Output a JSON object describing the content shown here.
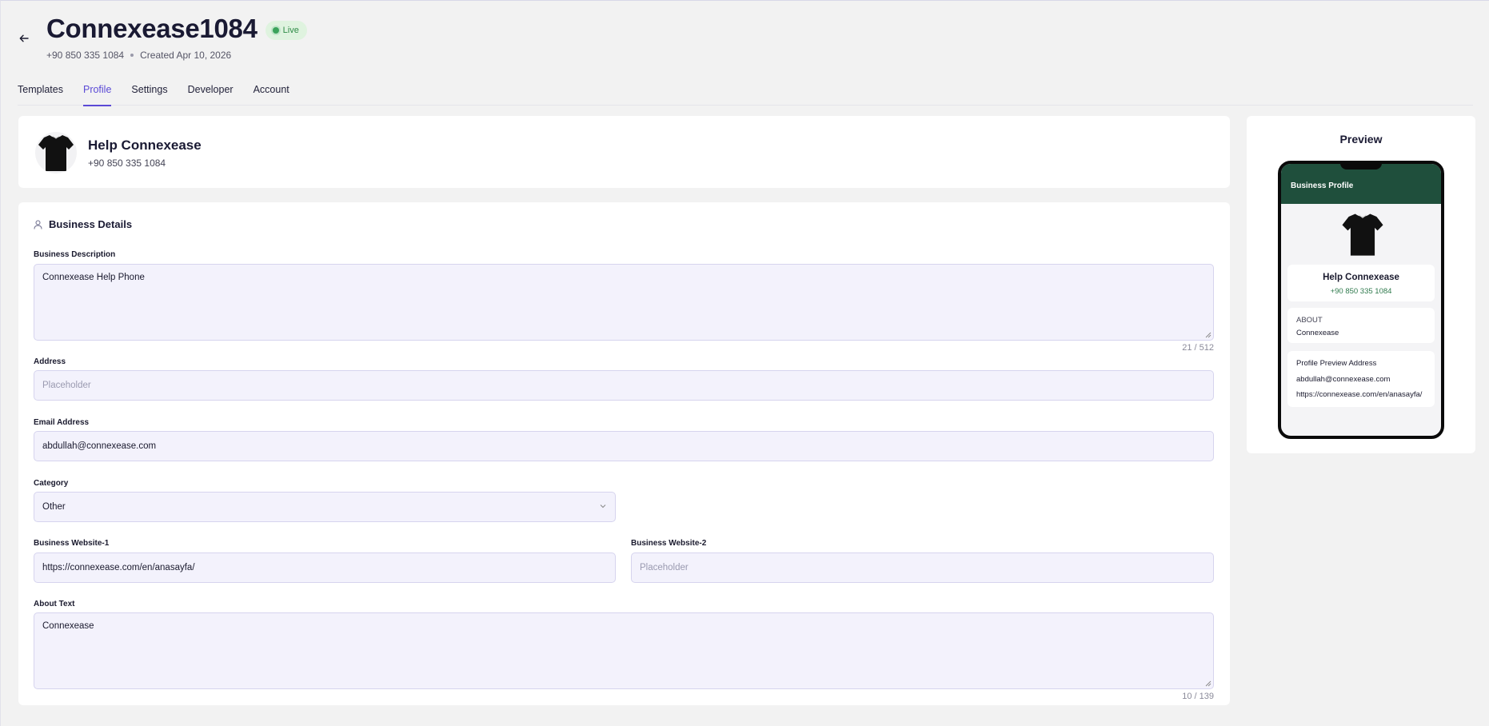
{
  "header": {
    "title": "Connexease1084",
    "status_badge": "Live",
    "phone": "+90 850 335 1084",
    "created": "Created Apr 10, 2026"
  },
  "tabs": [
    {
      "label": "Templates",
      "active": false
    },
    {
      "label": "Profile",
      "active": true
    },
    {
      "label": "Settings",
      "active": false
    },
    {
      "label": "Developer",
      "active": false
    },
    {
      "label": "Account",
      "active": false
    }
  ],
  "profile": {
    "name": "Help Connexease",
    "phone": "+90 850 335 1084"
  },
  "business_details": {
    "section_title": "Business Details",
    "description": {
      "label": "Business Description",
      "value": "Connexease Help Phone",
      "counter": "21 / 512"
    },
    "address": {
      "label": "Address",
      "placeholder": "Placeholder"
    },
    "email": {
      "label": "Email Address",
      "value": "abdullah@connexease.com"
    },
    "category": {
      "label": "Category",
      "value": "Other"
    },
    "website1": {
      "label": "Business Website-1",
      "value": "https://connexease.com/en/anasayfa/"
    },
    "website2": {
      "label": "Business Website-2",
      "placeholder": "Placeholder"
    },
    "about": {
      "label": "About Text",
      "value": "Connexease",
      "counter": "10 / 139"
    }
  },
  "preview": {
    "title": "Preview",
    "header_label": "Business Profile",
    "name": "Help Connexease",
    "phone": "+90 850 335 1084",
    "about_label": "ABOUT",
    "about_text": "Connexease",
    "address": "Profile Preview Address",
    "email": "abdullah@connexease.com",
    "website": "https://connexease.com/en/anasayfa/"
  },
  "colors": {
    "accent": "#5b4ad6",
    "live_green": "#3aa35a",
    "phone_header": "#1f4f3c",
    "field_bg": "#f3f2fc"
  },
  "icons": [
    "back-arrow-icon",
    "live-dot-icon",
    "tshirt-avatar-icon",
    "user-icon",
    "chevron-down-icon",
    "resize-grip-icon"
  ]
}
